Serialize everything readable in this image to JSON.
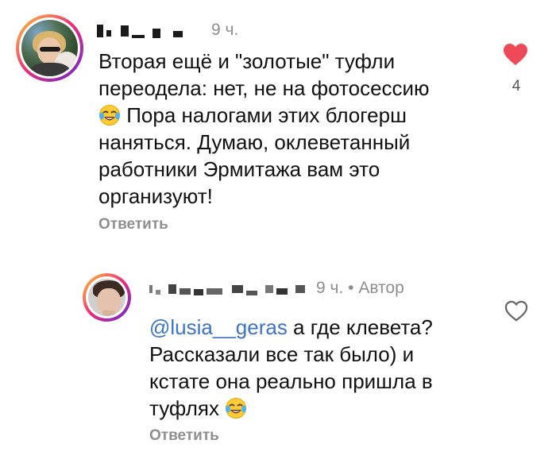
{
  "comments": [
    {
      "time": "9 ч.",
      "text_parts": [
        "Вторая ещё и \"золотые\" туфли",
        "переодела: нет, не на фотосессию",
        "Пора налогами этих блогерш",
        "наняться. Думаю, оклеветанный",
        "работники Эрмитажа вам это",
        "организуют!"
      ],
      "reply_label": "Ответить",
      "liked": true,
      "like_count": "4",
      "like_color": "#ed4956"
    },
    {
      "time": "9 ч.",
      "author_badge": "• Автор",
      "mention": "@lusia__geras",
      "text_parts": [
        " а где клевета?",
        "Рассказали все так было) и",
        "кстате она реально пришла в",
        "туфлях"
      ],
      "reply_label": "Ответить",
      "liked": false
    }
  ],
  "icons": {
    "heart_filled": "heart-filled-icon",
    "heart_outline": "heart-outline-icon",
    "emoji": "face-with-tears-of-joy-icon"
  },
  "colors": {
    "mention": "#3d74c4",
    "secondary_text": "#8e8e8e"
  }
}
